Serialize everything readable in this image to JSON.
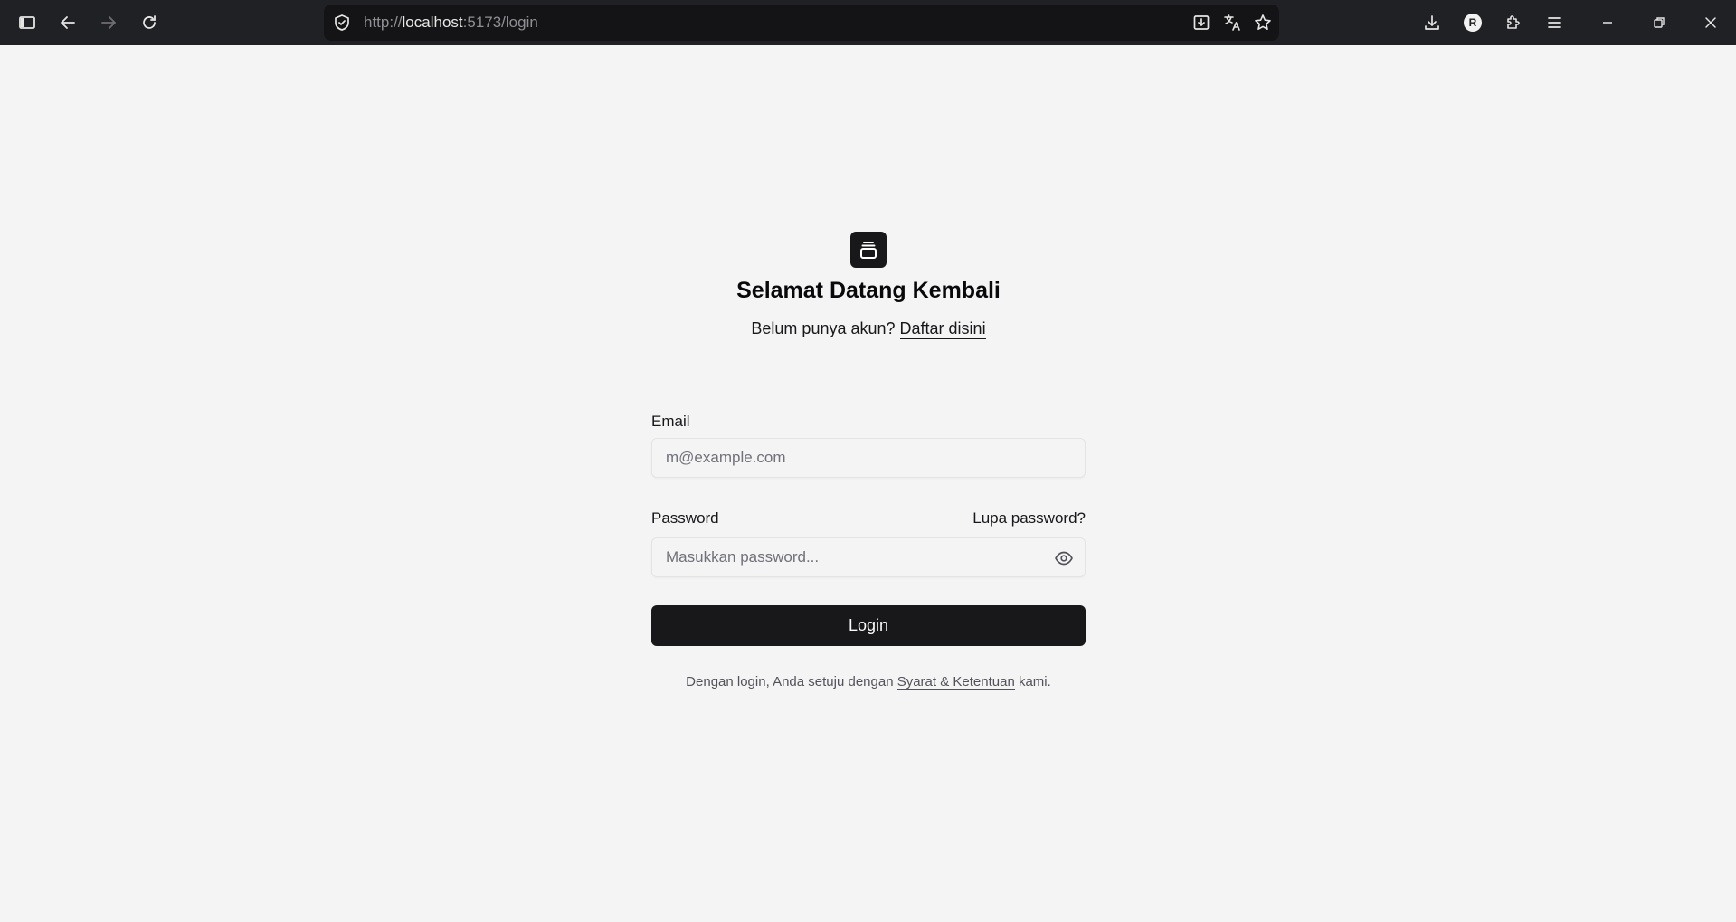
{
  "browser": {
    "url_prefix": "http://",
    "url_host": "localhost",
    "url_rest": ":5173/login",
    "profile_initial": "R",
    "icons": {
      "sidebar": "sidebar-icon",
      "back": "back-arrow-icon",
      "forward": "forward-arrow-icon",
      "reload": "reload-icon",
      "security": "shield-icon",
      "install": "install-app-icon",
      "translate": "translate-icon",
      "bookmark": "star-icon",
      "downloads": "download-icon",
      "extensions": "puzzle-icon",
      "menu": "menu-icon",
      "minimize": "minimize-icon",
      "restore": "restore-icon",
      "close": "close-icon"
    }
  },
  "login": {
    "title": "Selamat Datang Kembali",
    "signup_prompt": "Belum punya akun?",
    "signup_link": "Daftar disini",
    "email_label": "Email",
    "email_placeholder": "m@example.com",
    "password_label": "Password",
    "forgot_link": "Lupa password?",
    "password_placeholder": "Masukkan password...",
    "login_button": "Login",
    "terms_prefix": "Dengan login, Anda setuju dengan",
    "terms_link": "Syarat & Ketentuan",
    "terms_suffix": "kami."
  },
  "colors": {
    "page_bg": "#f4f4f4",
    "primary": "#18181b",
    "chrome_bg": "#202124"
  }
}
